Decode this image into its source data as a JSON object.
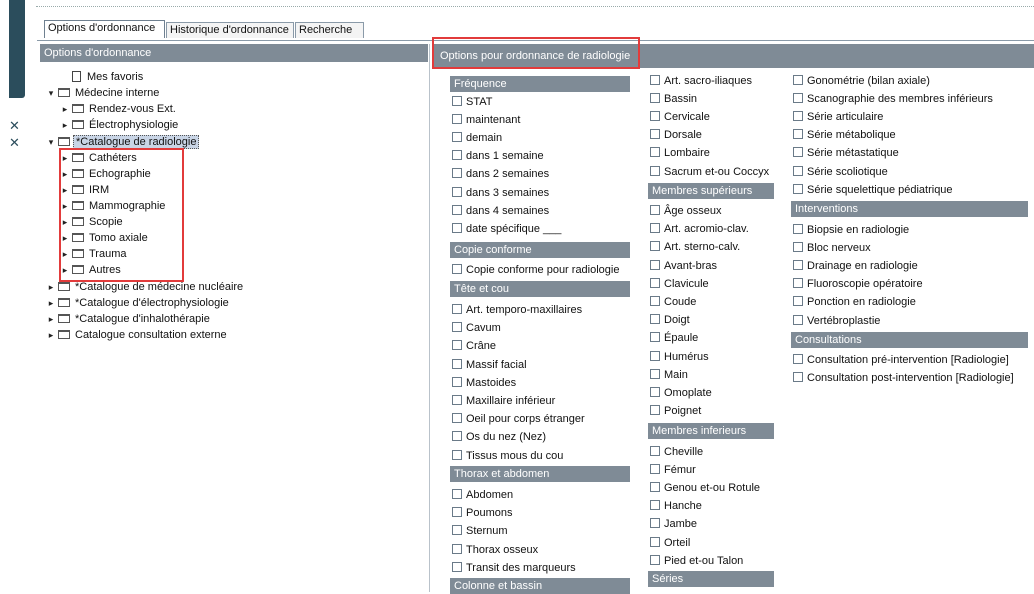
{
  "tabs": [
    "Options d'ordonnance",
    "Historique d'ordonnance",
    "Recherche"
  ],
  "left_panel": {
    "header": "Options d'ordonnance",
    "tree": [
      {
        "label": "Mes favoris",
        "icon": "doc"
      },
      {
        "label": "Médecine interne",
        "icon": "folder"
      },
      {
        "label": "Rendez-vous Ext.",
        "icon": "folder"
      },
      {
        "label": "Électrophysiologie",
        "icon": "folder"
      },
      {
        "label": "*Catalogue de radiologie",
        "icon": "folder"
      },
      {
        "label": "Cathéters",
        "icon": "folder"
      },
      {
        "label": "Echographie",
        "icon": "folder"
      },
      {
        "label": "IRM",
        "icon": "folder"
      },
      {
        "label": "Mammographie",
        "icon": "folder"
      },
      {
        "label": "Scopie",
        "icon": "folder"
      },
      {
        "label": "Tomo axiale",
        "icon": "folder"
      },
      {
        "label": "Trauma",
        "icon": "folder"
      },
      {
        "label": "Autres",
        "icon": "folder"
      },
      {
        "label": "*Catalogue de médecine nucléaire",
        "icon": "folder"
      },
      {
        "label": "*Catalogue d'électrophysiologie",
        "icon": "folder"
      },
      {
        "label": "*Catalogue d'inhalothérapie",
        "icon": "folder"
      },
      {
        "label": "Catalogue consultation externe",
        "icon": "folder"
      }
    ]
  },
  "right_panel": {
    "header": "Options pour ordonnance de radiologie",
    "col1": {
      "frequence": {
        "title": "Fréquence",
        "items": [
          "STAT",
          "maintenant",
          "demain",
          "dans 1 semaine",
          "dans 2 semaines",
          "dans 3 semaines",
          "dans 4 semaines",
          "date spécifique ___"
        ]
      },
      "copie": {
        "title": "Copie conforme",
        "items": [
          "Copie conforme pour radiologie"
        ]
      },
      "tete": {
        "title": "Tête et cou",
        "items": [
          "Art. temporo-maxillaires",
          "Cavum",
          "Crâne",
          "Massif facial",
          "Mastoides",
          "Maxillaire inférieur",
          "Oeil pour corps étranger",
          "Os du nez (Nez)",
          "Tissus mous du cou"
        ]
      },
      "thorax": {
        "title": "Thorax et abdomen",
        "items": [
          "Abdomen",
          "Poumons",
          "Sternum",
          "Thorax osseux",
          "Transit des marqueurs"
        ]
      },
      "colonne": {
        "title": "Colonne et bassin"
      }
    },
    "col2": {
      "top": {
        "items": [
          "Art. sacro-iliaques",
          "Bassin",
          "Cervicale",
          "Dorsale",
          "Lombaire",
          "Sacrum et-ou Coccyx"
        ]
      },
      "msup": {
        "title": "Membres supérieurs",
        "items": [
          "Âge osseux",
          "Art. acromio-clav.",
          "Art. sterno-calv.",
          "Avant-bras",
          "Clavicule",
          "Coude",
          "Doigt",
          "Épaule",
          "Humérus",
          "Main",
          "Omoplate",
          "Poignet"
        ]
      },
      "minf": {
        "title": "Membres inferieurs",
        "items": [
          "Cheville",
          "Fémur",
          "Genou et-ou Rotule",
          "Hanche",
          "Jambe",
          "Orteil",
          "Pied et-ou Talon"
        ]
      },
      "series": {
        "title": "Séries"
      }
    },
    "col3": {
      "top": {
        "items": [
          "Gonométrie (bilan axiale)",
          "Scanographie des membres inférieurs",
          "Série articulaire",
          "Série métabolique",
          "Série métastatique",
          "Série scoliotique",
          "Série squelettique pédiatrique"
        ]
      },
      "interventions": {
        "title": "Interventions",
        "items": [
          "Biopsie en radiologie",
          "Bloc nerveux",
          "Drainage en radiologie",
          "Fluoroscopie opératoire",
          "Ponction en radiologie",
          "Vertébroplastie"
        ]
      },
      "consultations": {
        "title": "Consultations",
        "items": [
          "Consultation pré-intervention [Radiologie]",
          "Consultation post-intervention [Radiologie]"
        ]
      }
    }
  },
  "colors": {
    "section_header": "#7f8b96",
    "highlight": "#e23b3b",
    "sidebar": "#2b4d5c"
  }
}
